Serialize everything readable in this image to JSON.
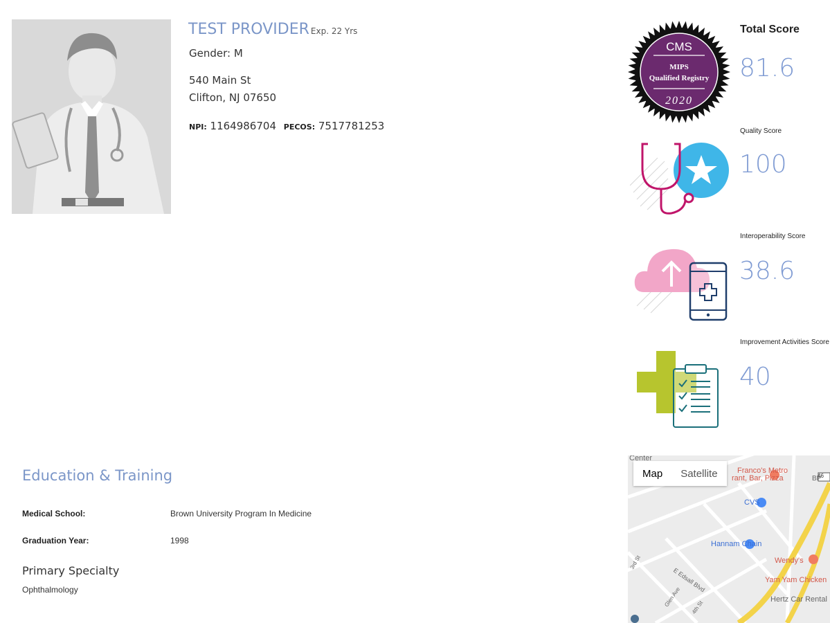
{
  "provider": {
    "name": "TEST PROVIDER",
    "experience": "Exp. 22 Yrs",
    "gender": "Gender: M",
    "address_line1": "540 Main St",
    "address_line2": "Clifton, NJ 07650",
    "npi_label": "NPI:",
    "npi": "1164986704",
    "pecos_label": "PECOS:",
    "pecos": "7517781253"
  },
  "badge": {
    "line1": "CMS",
    "line2": "MIPS",
    "line3": "Qualified Registry",
    "line4": "2020"
  },
  "scores": {
    "total": {
      "title": "Total Score",
      "value": "81.6"
    },
    "quality": {
      "title": "Quality Score",
      "value": "100"
    },
    "interoperability": {
      "title": "Interoperability Score",
      "value": "38.6"
    },
    "improvement": {
      "title": "Improvement Activities Score",
      "value": "40"
    }
  },
  "education": {
    "heading": "Education & Training",
    "medical_school_label": "Medical School:",
    "medical_school": "Brown University Program In Medicine",
    "graduation_label": "Graduation Year:",
    "graduation_year": "1998",
    "specialty_heading": "Primary Specialty",
    "specialty": "Ophthalmology"
  },
  "map": {
    "map_tab": "Map",
    "satellite_tab": "Satellite",
    "labels": {
      "center": "Center",
      "francos": "Franco's Metro",
      "francos2": "rant, Bar, Pizza",
      "bp": "BP",
      "cvs": "CVS",
      "hannam": "Hannam Chain",
      "wendys": "Wendy's",
      "yamyam": "Yam Yam Chicken",
      "hertz": "Hertz Car Rental",
      "edsall": "E Edsall Blvd",
      "glen": "Glen Ave",
      "third": "3rd St",
      "fourth": "4th St",
      "route": "46"
    }
  },
  "colors": {
    "accent": "#7b96c8",
    "score": "#7f9bd3",
    "badge_purple": "#6b2a6e",
    "quality_blue": "#3fb6e8",
    "quality_magenta": "#c0156a",
    "cloud_pink": "#f2a6c8",
    "device_navy": "#1f3e6b",
    "plus_green": "#b7c52e",
    "clipboard_teal": "#1a6f7a"
  }
}
